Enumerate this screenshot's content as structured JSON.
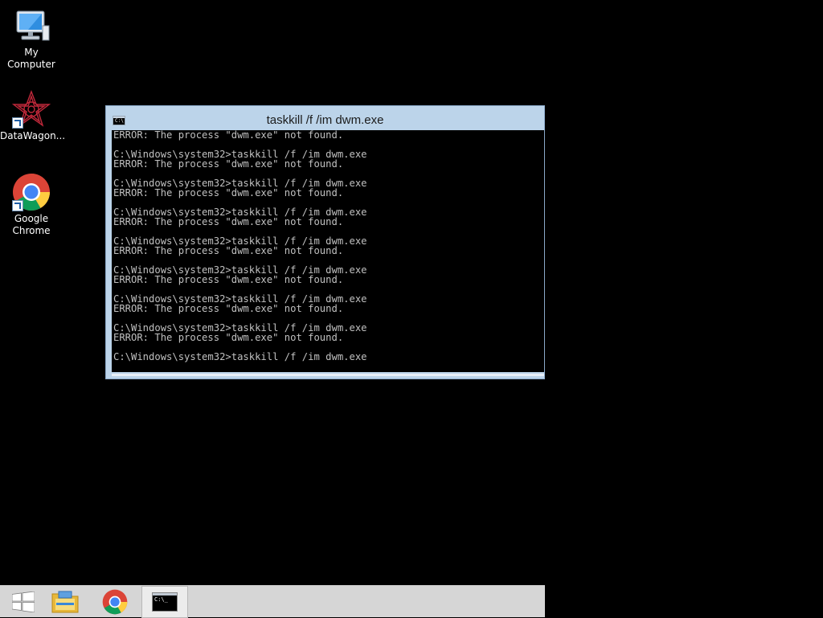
{
  "desktop": {
    "icons": [
      {
        "label": "My Computer",
        "icon": "computer-icon"
      },
      {
        "label": "DataWagon...",
        "icon": "datawagon-icon"
      },
      {
        "label_line1": "Google",
        "label_line2": "Chrome",
        "icon": "chrome-icon"
      }
    ]
  },
  "cmd_window": {
    "title": "taskkill  /f /im dwm.exe",
    "icon_text": "C:\\",
    "lines": [
      "ERROR: The process \"dwm.exe\" not found.",
      "",
      "C:\\Windows\\system32>taskkill /f /im dwm.exe",
      "ERROR: The process \"dwm.exe\" not found.",
      "",
      "C:\\Windows\\system32>taskkill /f /im dwm.exe",
      "ERROR: The process \"dwm.exe\" not found.",
      "",
      "C:\\Windows\\system32>taskkill /f /im dwm.exe",
      "ERROR: The process \"dwm.exe\" not found.",
      "",
      "C:\\Windows\\system32>taskkill /f /im dwm.exe",
      "ERROR: The process \"dwm.exe\" not found.",
      "",
      "C:\\Windows\\system32>taskkill /f /im dwm.exe",
      "ERROR: The process \"dwm.exe\" not found.",
      "",
      "C:\\Windows\\system32>taskkill /f /im dwm.exe",
      "ERROR: The process \"dwm.exe\" not found.",
      "",
      "C:\\Windows\\system32>taskkill /f /im dwm.exe",
      "ERROR: The process \"dwm.exe\" not found.",
      "",
      "C:\\Windows\\system32>taskkill /f /im dwm.exe"
    ]
  },
  "taskbar": {
    "items": [
      {
        "icon": "windows-start-icon"
      },
      {
        "icon": "file-explorer-icon"
      },
      {
        "icon": "chrome-icon"
      },
      {
        "icon": "command-prompt-icon",
        "active": true,
        "icon_text": "C:\\_"
      }
    ]
  },
  "colors": {
    "desktop_bg": "#000000",
    "window_frame": "#bcd4ea",
    "console_text": "#c0c0c0",
    "taskbar_bg": "#d6d6d6"
  }
}
